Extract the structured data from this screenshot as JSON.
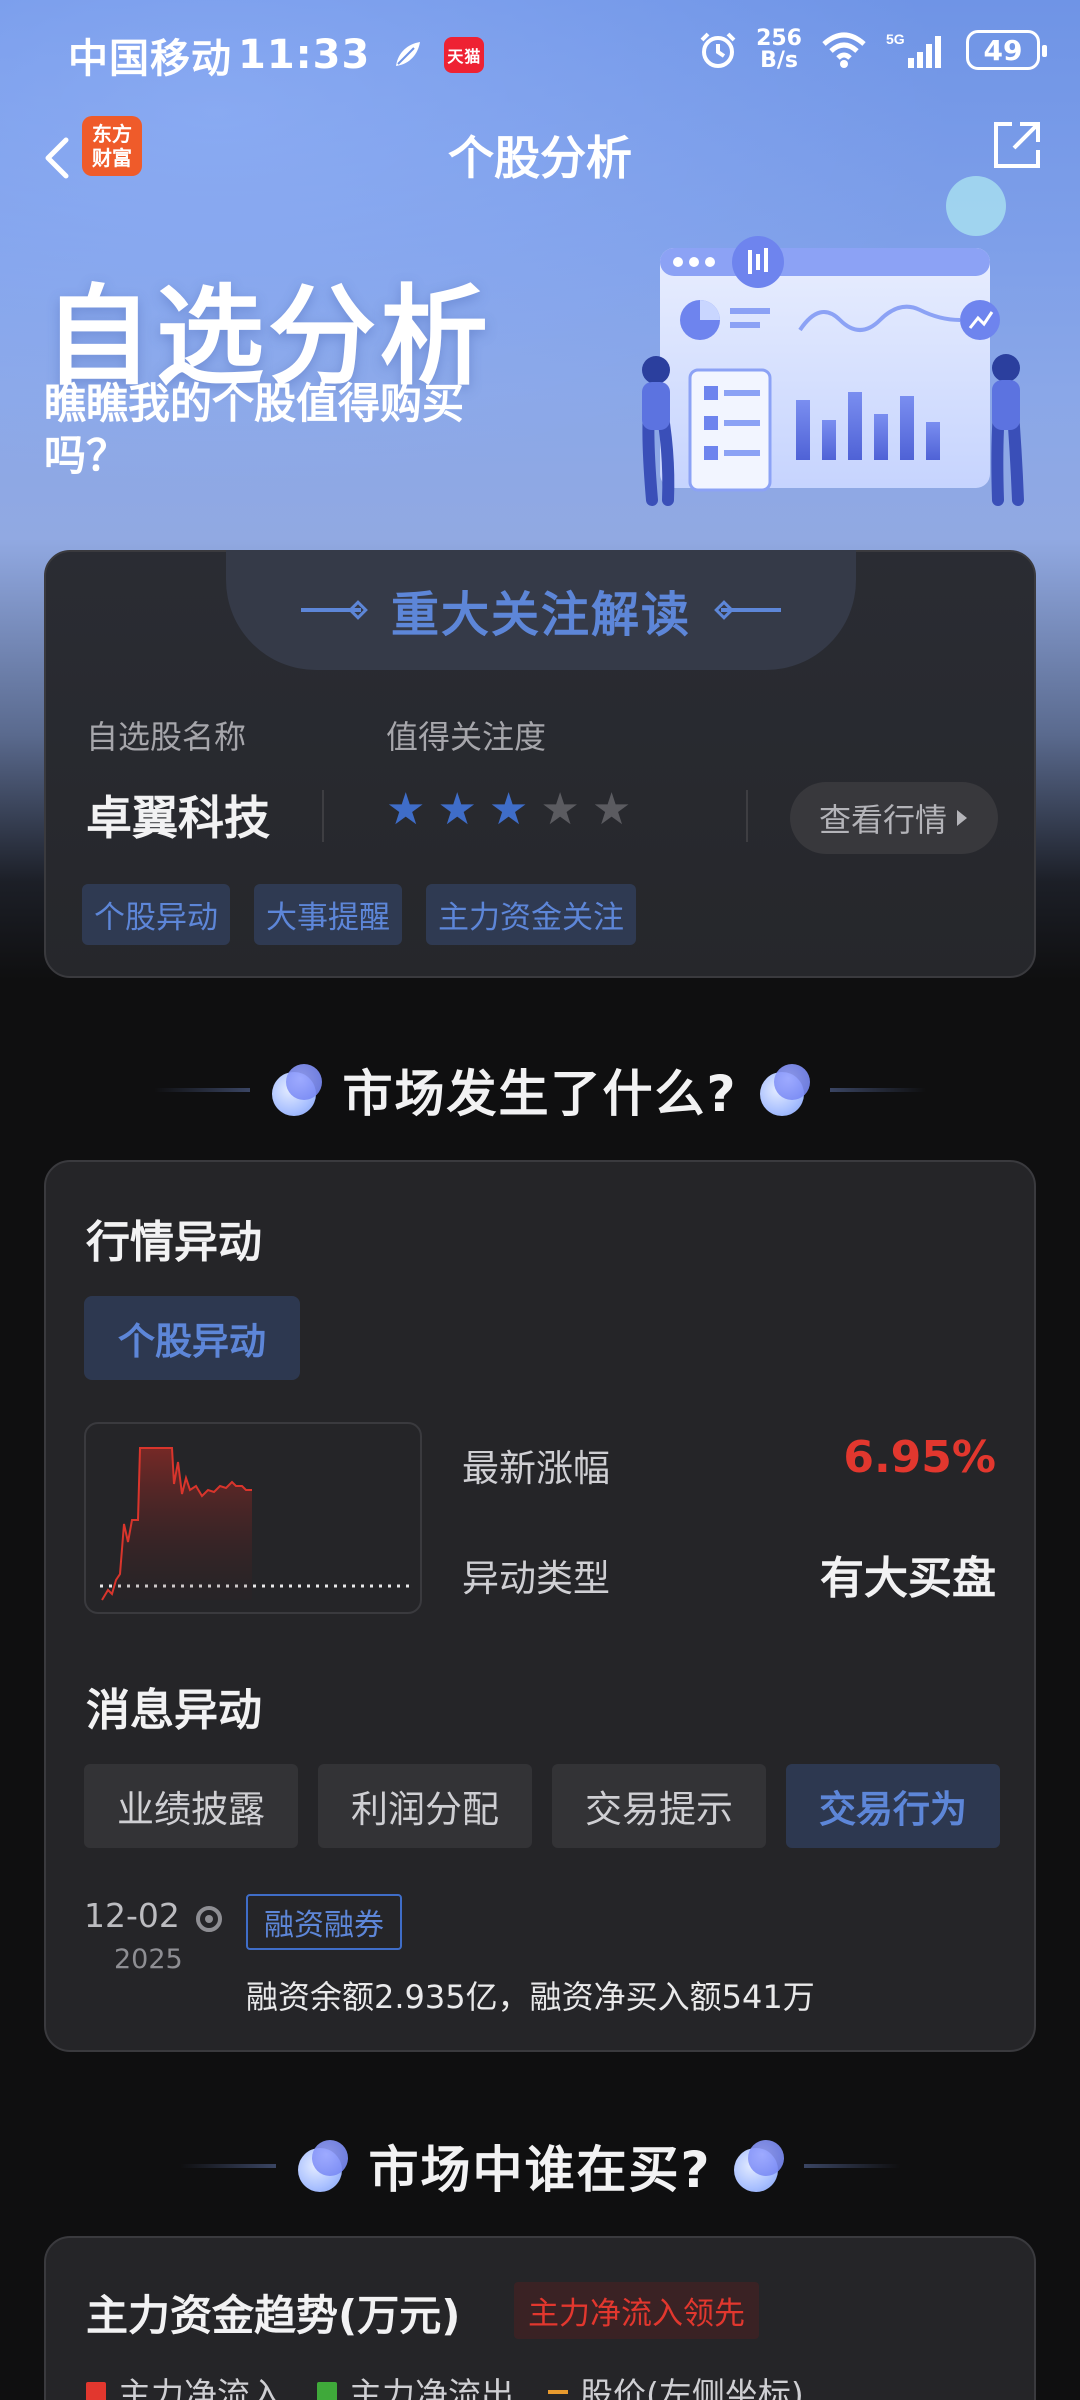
{
  "status_bar": {
    "carrier": "中国移动",
    "time": "11:33",
    "tmall_label": "天猫",
    "net_speed_value": "256",
    "net_speed_unit": "B/s",
    "battery": "49",
    "icons": [
      "leaf-icon",
      "tmall-icon",
      "alarm-icon",
      "wifi-icon",
      "signal-5g-icon",
      "battery-icon"
    ]
  },
  "nav": {
    "title": "个股分析",
    "logo_line1": "东方",
    "logo_line2": "财富"
  },
  "hero": {
    "title": "自选分析",
    "subtitle": "瞧瞧我的个股值得购买吗？"
  },
  "focus_card": {
    "heading": "重大关注解读",
    "name_label": "自选股名称",
    "attention_label": "值得关注度",
    "stock_name": "卓翼科技",
    "rating": 3,
    "rating_max": 5,
    "view_button": "查看行情",
    "tags": [
      "个股异动",
      "大事提醒",
      "主力资金关注"
    ]
  },
  "section1": {
    "title": "市场发生了什么?"
  },
  "market_card": {
    "title": "行情异动",
    "active_pill": "个股异动",
    "latest_change_label": "最新涨幅",
    "latest_change_value": "6.95%",
    "type_label": "异动类型",
    "type_value": "有大买盘",
    "news_title": "消息异动",
    "news_tabs": [
      "业绩披露",
      "利润分配",
      "交易提示",
      "交易行为"
    ],
    "active_news_tab": 3,
    "news_date": "12-02",
    "news_year": "2025",
    "news_tag": "融资融券",
    "news_text": "融资余额2.935亿，融资净买入额541万"
  },
  "section2": {
    "title": "市场中谁在买?"
  },
  "flow_card": {
    "title": "主力资金趋势(万元)",
    "badge": "主力净流入领先",
    "legend": [
      {
        "label": "主力净流入",
        "color": "#e2372e",
        "kind": "square"
      },
      {
        "label": "主力净流出",
        "color": "#3fa93a",
        "kind": "square"
      },
      {
        "label": "股价(左侧坐标)",
        "color": "#e89a2e",
        "kind": "line"
      }
    ]
  },
  "colors": {
    "accent_blue": "#5d86d8",
    "up_red": "#e2372e",
    "down_green": "#3fa93a"
  }
}
